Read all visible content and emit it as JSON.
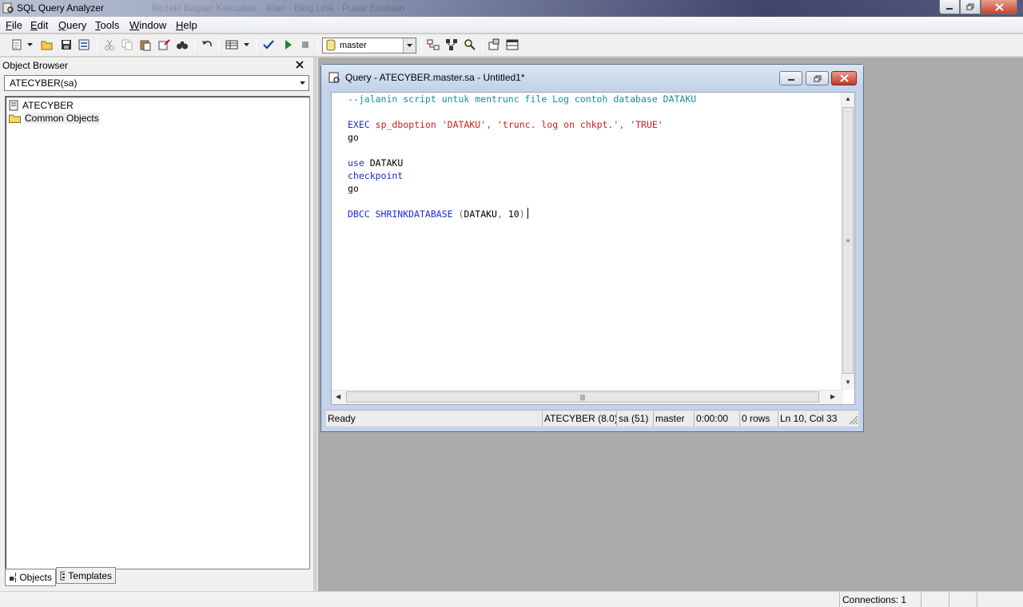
{
  "window": {
    "title": "SQL Query Analyzer",
    "background_title": "Rezeki Bagian Kekuatan · Iklan · Blog Link · Pusat Bantuan"
  },
  "menu": [
    "File",
    "Edit",
    "Query",
    "Tools",
    "Window",
    "Help"
  ],
  "toolbar": {
    "database_selected": "master",
    "buttons": [
      "new-query",
      "dropdown",
      "open",
      "save",
      "load-script",
      "cut",
      "copy",
      "paste",
      "clear-window",
      "find",
      "undo",
      "execute-mode",
      "dropdown",
      "parse",
      "execute",
      "cancel",
      "show-plan",
      "trace",
      "index-tuning",
      "object-search",
      "results-pane"
    ]
  },
  "object_browser": {
    "title": "Object Browser",
    "server_select": "ATECYBER(sa)",
    "tree": [
      {
        "label": "ATECYBER",
        "icon": "server-icon"
      },
      {
        "label": "Common Objects",
        "icon": "folder-icon"
      }
    ],
    "tabs": [
      "Objects",
      "Templates"
    ]
  },
  "query_window": {
    "title": "Query - ATECYBER.master.sa - Untitled1*",
    "code": [
      [
        {
          "t": "--jalanin script untuk mentrunc file Log contoh database DATAKU",
          "c": "comment"
        }
      ],
      [],
      [
        {
          "t": "EXEC",
          "c": "kw"
        },
        {
          "t": " ",
          "c": "id"
        },
        {
          "t": "sp_dboption",
          "c": "str"
        },
        {
          "t": " ",
          "c": "id"
        },
        {
          "t": "'DATAKU'",
          "c": "str"
        },
        {
          "t": ", ",
          "c": "paren"
        },
        {
          "t": "'trunc. log on chkpt.'",
          "c": "str"
        },
        {
          "t": ", ",
          "c": "paren"
        },
        {
          "t": "'TRUE'",
          "c": "str"
        }
      ],
      [
        {
          "t": "go",
          "c": "id"
        }
      ],
      [],
      [
        {
          "t": "use",
          "c": "kw"
        },
        {
          "t": " DATAKU",
          "c": "id"
        }
      ],
      [
        {
          "t": "checkpoint",
          "c": "kw"
        }
      ],
      [
        {
          "t": "go",
          "c": "id"
        }
      ],
      [],
      [
        {
          "t": "DBCC SHRINKDATABASE",
          "c": "kw"
        },
        {
          "t": " (",
          "c": "paren"
        },
        {
          "t": "DATAKU",
          "c": "id"
        },
        {
          "t": ", ",
          "c": "paren"
        },
        {
          "t": "10",
          "c": "id"
        },
        {
          "t": ")",
          "c": "paren"
        }
      ]
    ],
    "status": {
      "state": "Ready",
      "server": "ATECYBER (8.0)",
      "user": "sa (51)",
      "database": "master",
      "elapsed": "0:00:00",
      "rows": "0 rows",
      "position": "Ln 10, Col 33"
    }
  },
  "statusbar": {
    "connections": "Connections: 1"
  },
  "colors": {
    "comment": "#119191",
    "keyword": "#1a2bd7",
    "string": "#d21c1c",
    "mdi_background": "#ababab"
  }
}
